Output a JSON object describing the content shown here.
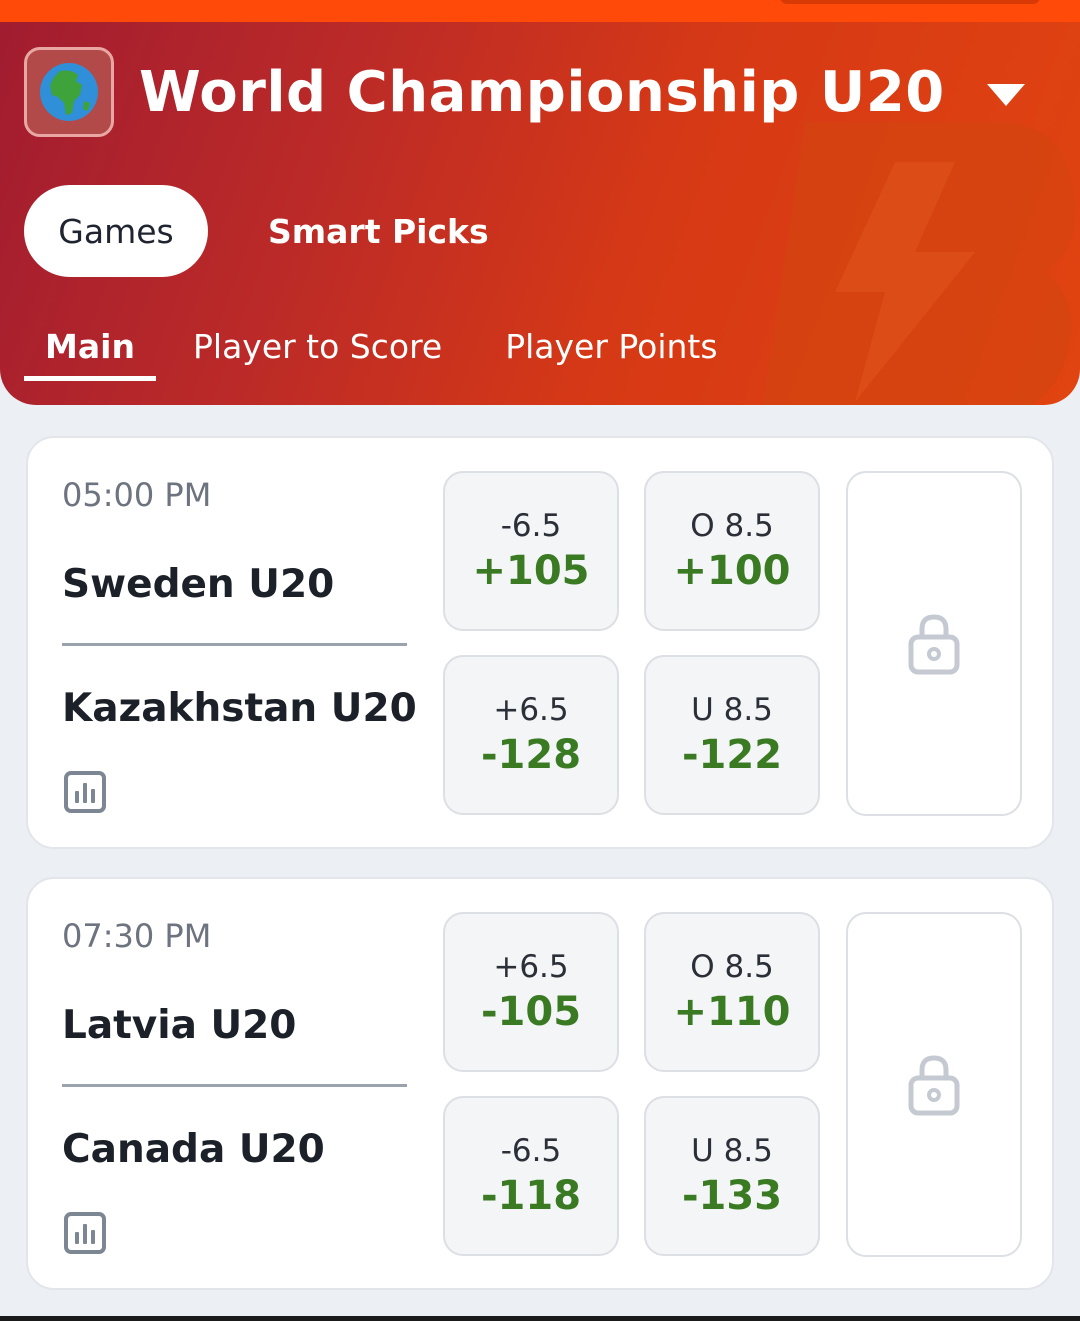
{
  "header": {
    "league_title": "World Championship U20",
    "league_icon": "globe-icon",
    "tabs": [
      {
        "label": "Games",
        "active": true
      },
      {
        "label": "Smart Picks",
        "active": false
      }
    ],
    "subtabs": [
      {
        "label": "Main",
        "active": true
      },
      {
        "label": "Player to Score",
        "active": false
      },
      {
        "label": "Player Points",
        "active": false
      }
    ]
  },
  "games": [
    {
      "time": "05:00 PM",
      "home": "Sweden U20",
      "away": "Kazakhstan U20",
      "odds": [
        {
          "line": "-6.5",
          "price": "+105"
        },
        {
          "line": "O 8.5",
          "price": "+100"
        },
        {
          "line": "+6.5",
          "price": "-128"
        },
        {
          "line": "U 8.5",
          "price": "-122"
        }
      ],
      "moneyline_locked": true
    },
    {
      "time": "07:30 PM",
      "home": "Latvia U20",
      "away": "Canada U20",
      "odds": [
        {
          "line": "+6.5",
          "price": "-105"
        },
        {
          "line": "O 8.5",
          "price": "+110"
        },
        {
          "line": "-6.5",
          "price": "-118"
        },
        {
          "line": "U 8.5",
          "price": "-133"
        }
      ],
      "moneyline_locked": true
    }
  ],
  "colors": {
    "accent": "#e14410",
    "header_start": "#a11c30",
    "odds_green": "#3a7a23"
  }
}
